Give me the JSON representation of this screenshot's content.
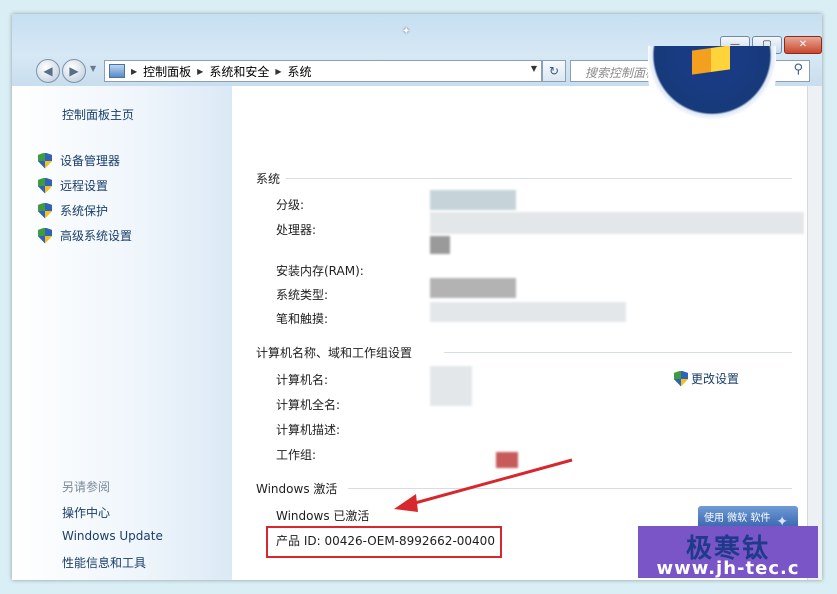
{
  "window": {
    "caption_arrow": "✦",
    "minimize": "—",
    "maximize": "▢",
    "close": "✕"
  },
  "nav": {
    "back": "◀",
    "forward": "▶",
    "breadcrumb": [
      "控制面板",
      "系统和安全",
      "系统"
    ],
    "search_placeholder": "搜索控制面板"
  },
  "sidebar": {
    "home": "控制面板主页",
    "links": [
      "设备管理器",
      "远程设置",
      "系统保护",
      "高级系统设置"
    ],
    "see_also": "另请参阅",
    "footer_links": [
      "操作中心",
      "Windows Update",
      "性能信息和工具"
    ]
  },
  "system": {
    "heading": "系统",
    "labels": [
      "分级:",
      "处理器:",
      "安装内存(RAM):",
      "系统类型:",
      "笔和触摸:"
    ]
  },
  "computer": {
    "heading": "计算机名称、域和工作组设置",
    "labels": [
      "计算机名:",
      "计算机全名:",
      "计算机描述:",
      "工作组:"
    ],
    "change_settings": "更改设置"
  },
  "activation": {
    "heading": "Windows 激活",
    "status": "Windows 已激活",
    "product_id": "产品 ID: 00426-OEM-8992662-00400",
    "genuine_badge": "使用 微软 软件"
  },
  "watermark": {
    "title": "极寒钛",
    "url": "www.jh-tec.c"
  },
  "colors": {
    "link": "#1a3e6a",
    "highlight_box": "#d6282d",
    "watermark_bg": "#7a55c7"
  }
}
